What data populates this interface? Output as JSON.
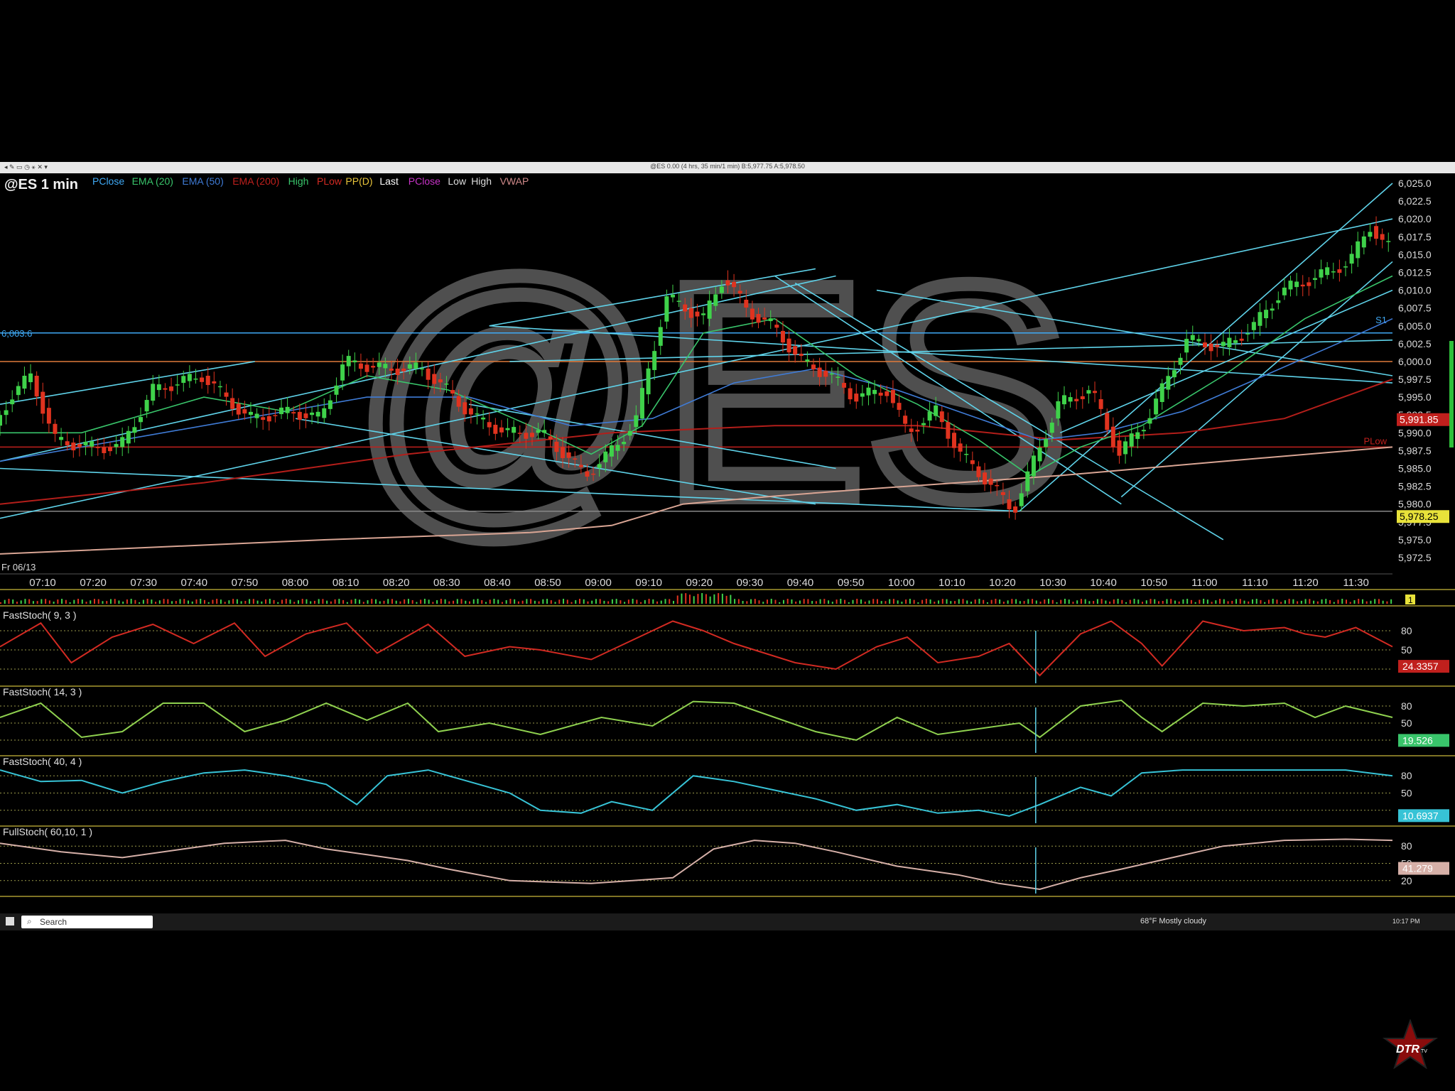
{
  "window": {
    "title": "@ES 0.00 (4 hrs, 35 min/1 min) B:5,977.75 A:5,978.50"
  },
  "chart_header": {
    "symbol": "@ES 1 min",
    "watermark": "@ES",
    "legend": [
      {
        "label": "PClose",
        "color": "#3fa9f5"
      },
      {
        "label": "EMA (20)",
        "color": "#39c56b"
      },
      {
        "label": "EMA (50)",
        "color": "#3f7bd6"
      },
      {
        "label": "EMA (200)",
        "color": "#c0201d"
      },
      {
        "label": "High",
        "color": "#39c56b"
      },
      {
        "label": "PLow",
        "color": "#d22a22"
      },
      {
        "label": "PP(D)",
        "color": "#e8c43a"
      },
      {
        "label": "Last",
        "color": "#ffffff"
      },
      {
        "label": "PClose",
        "color": "#c733c7"
      },
      {
        "label": "Low",
        "color": "#dddddd"
      },
      {
        "label": "High",
        "color": "#dddddd"
      },
      {
        "label": "VWAP",
        "color": "#d08a8a"
      }
    ],
    "date_label": "Fr 06/13",
    "left_level_label": "6,003.6"
  },
  "chart_data": {
    "type": "candlestick",
    "title": "@ES 1 min",
    "x_ticks": [
      "07:10",
      "07:20",
      "07:30",
      "07:40",
      "07:50",
      "08:00",
      "08:10",
      "08:20",
      "08:30",
      "08:40",
      "08:50",
      "09:00",
      "09:10",
      "09:20",
      "09:30",
      "09:40",
      "09:50",
      "10:00",
      "10:10",
      "10:20",
      "10:30",
      "10:40",
      "10:50",
      "11:00",
      "11:10",
      "11:20",
      "11:30"
    ],
    "y_ticks": [
      "6,025.0",
      "6,022.5",
      "6,020.0",
      "6,017.5",
      "6,015.0",
      "6,012.5",
      "6,010.0",
      "6,007.5",
      "6,005.0",
      "6,002.5",
      "6,000.0",
      "5,997.5",
      "5,995.0",
      "5,992.5",
      "5,990.0",
      "5,987.5",
      "5,985.0",
      "5,982.5",
      "5,980.0",
      "5,977.5",
      "5,975.0",
      "5,972.5"
    ],
    "ylim": [
      5971,
      6026
    ],
    "price_path": [
      [
        0,
        5991
      ],
      [
        8,
        5995
      ],
      [
        18,
        5998
      ],
      [
        30,
        5989
      ],
      [
        46,
        5988
      ],
      [
        62,
        5988
      ],
      [
        78,
        5996
      ],
      [
        102,
        5998
      ],
      [
        125,
        5992
      ],
      [
        146,
        5993
      ],
      [
        160,
        5992
      ],
      [
        172,
        6000
      ],
      [
        190,
        5999
      ],
      [
        210,
        5999
      ],
      [
        222,
        5996
      ],
      [
        236,
        5992
      ],
      [
        252,
        5990
      ],
      [
        268,
        5990
      ],
      [
        280,
        5987
      ],
      [
        290,
        5984
      ],
      [
        305,
        5988
      ],
      [
        315,
        5992
      ],
      [
        330,
        6009
      ],
      [
        348,
        6006
      ],
      [
        358,
        6012
      ],
      [
        370,
        6007
      ],
      [
        382,
        6005
      ],
      [
        396,
        6000
      ],
      [
        410,
        5998
      ],
      [
        422,
        5995
      ],
      [
        438,
        5996
      ],
      [
        448,
        5990
      ],
      [
        462,
        5993
      ],
      [
        474,
        5987
      ],
      [
        488,
        5983
      ],
      [
        500,
        5979
      ],
      [
        510,
        5986
      ],
      [
        522,
        5994
      ],
      [
        538,
        5996
      ],
      [
        552,
        5987
      ],
      [
        566,
        5992
      ],
      [
        585,
        6003
      ],
      [
        603,
        6002
      ],
      [
        618,
        6005
      ],
      [
        632,
        6010
      ],
      [
        650,
        6012
      ],
      [
        665,
        6014
      ],
      [
        675,
        6019
      ],
      [
        683,
        6016
      ]
    ],
    "ema20": [
      [
        0,
        5990
      ],
      [
        40,
        5990
      ],
      [
        100,
        5995
      ],
      [
        140,
        5993
      ],
      [
        180,
        5998
      ],
      [
        220,
        5996
      ],
      [
        260,
        5991
      ],
      [
        290,
        5987
      ],
      [
        315,
        5991
      ],
      [
        345,
        6004
      ],
      [
        380,
        6006
      ],
      [
        420,
        5998
      ],
      [
        450,
        5994
      ],
      [
        480,
        5989
      ],
      [
        505,
        5984
      ],
      [
        530,
        5988
      ],
      [
        560,
        5991
      ],
      [
        600,
        5998
      ],
      [
        640,
        6006
      ],
      [
        683,
        6012
      ]
    ],
    "ema50": [
      [
        0,
        5986
      ],
      [
        60,
        5989
      ],
      [
        120,
        5992
      ],
      [
        180,
        5995
      ],
      [
        230,
        5995
      ],
      [
        280,
        5991
      ],
      [
        320,
        5992
      ],
      [
        360,
        5997
      ],
      [
        400,
        5999
      ],
      [
        440,
        5996
      ],
      [
        480,
        5992
      ],
      [
        510,
        5989
      ],
      [
        540,
        5990
      ],
      [
        580,
        5993
      ],
      [
        620,
        5998
      ],
      [
        660,
        6003
      ],
      [
        683,
        6006
      ]
    ],
    "ema200": [
      [
        0,
        5980
      ],
      [
        100,
        5983
      ],
      [
        200,
        5987
      ],
      [
        300,
        5990
      ],
      [
        380,
        5991
      ],
      [
        450,
        5991
      ],
      [
        520,
        5989
      ],
      [
        580,
        5990
      ],
      [
        630,
        5992
      ],
      [
        683,
        5997.5
      ]
    ],
    "vwap": [
      [
        0,
        5973
      ],
      [
        80,
        5974
      ],
      [
        160,
        5975
      ],
      [
        260,
        5976
      ],
      [
        300,
        5977
      ],
      [
        335,
        5980
      ],
      [
        375,
        5981
      ],
      [
        420,
        5982
      ],
      [
        470,
        5983
      ],
      [
        520,
        5984
      ],
      [
        600,
        5986
      ],
      [
        683,
        5988
      ]
    ],
    "levels": [
      {
        "name": "S1",
        "value": 6004,
        "color": "#3fa9f5"
      },
      {
        "name": "PClose",
        "value": 6000,
        "color": "#e07a3a"
      },
      {
        "name": "PLow",
        "value": 5988,
        "color": "#c0201d"
      },
      {
        "name": "",
        "value": 5979,
        "color": "#888888"
      }
    ],
    "price_badges": [
      {
        "text": "5,991.85",
        "value": 5991.85,
        "color": "#c0201d"
      },
      {
        "text": "5,978.25",
        "value": 5978.25,
        "color": "#e8e23a"
      }
    ],
    "level_tags": [
      {
        "text": "S1",
        "value": 6005
      },
      {
        "text": "PLow",
        "value": 5988
      }
    ],
    "trendlines": [
      [
        [
          0,
          5978
        ],
        [
          683,
          6020
        ]
      ],
      [
        [
          0,
          5986
        ],
        [
          410,
          6012
        ]
      ],
      [
        [
          0,
          5994
        ],
        [
          125,
          6000
        ]
      ],
      [
        [
          240,
          6005
        ],
        [
          400,
          6013
        ]
      ],
      [
        [
          240,
          6005
        ],
        [
          683,
          5997
        ]
      ],
      [
        [
          145,
          5992
        ],
        [
          400,
          5980
        ]
      ],
      [
        [
          230,
          5994
        ],
        [
          410,
          5985
        ]
      ],
      [
        [
          380,
          6012
        ],
        [
          550,
          5980
        ]
      ],
      [
        [
          390,
          6011
        ],
        [
          600,
          5975
        ]
      ],
      [
        [
          500,
          5979
        ],
        [
          683,
          6025
        ]
      ],
      [
        [
          430,
          6010
        ],
        [
          683,
          5998
        ]
      ],
      [
        [
          0,
          5985
        ],
        [
          500,
          5979
        ]
      ],
      [
        [
          520,
          5990
        ],
        [
          683,
          6010
        ]
      ],
      [
        [
          250,
          6000
        ],
        [
          683,
          6003
        ]
      ],
      [
        [
          550,
          5981
        ],
        [
          683,
          6014
        ]
      ]
    ],
    "indicators": [
      {
        "label": "FastStoch( 9, 3 )",
        "color": "#d22a22",
        "value_text": "24.3357",
        "badge_color": "#c0201d",
        "ticks": [
          "80",
          "50"
        ],
        "levels": [
          80,
          50,
          20
        ],
        "series": [
          [
            0,
            55
          ],
          [
            20,
            92
          ],
          [
            35,
            30
          ],
          [
            55,
            70
          ],
          [
            75,
            90
          ],
          [
            95,
            60
          ],
          [
            115,
            92
          ],
          [
            130,
            40
          ],
          [
            150,
            75
          ],
          [
            170,
            92
          ],
          [
            185,
            45
          ],
          [
            210,
            90
          ],
          [
            228,
            40
          ],
          [
            250,
            55
          ],
          [
            265,
            50
          ],
          [
            290,
            35
          ],
          [
            310,
            65
          ],
          [
            330,
            95
          ],
          [
            345,
            80
          ],
          [
            360,
            60
          ],
          [
            390,
            30
          ],
          [
            410,
            20
          ],
          [
            430,
            55
          ],
          [
            445,
            70
          ],
          [
            460,
            30
          ],
          [
            480,
            40
          ],
          [
            495,
            60
          ],
          [
            510,
            10
          ],
          [
            530,
            75
          ],
          [
            545,
            95
          ],
          [
            560,
            60
          ],
          [
            570,
            25
          ],
          [
            590,
            95
          ],
          [
            610,
            80
          ],
          [
            630,
            85
          ],
          [
            640,
            75
          ],
          [
            650,
            70
          ],
          [
            665,
            85
          ],
          [
            683,
            55
          ]
        ]
      },
      {
        "label": "FastStoch( 14, 3 )",
        "color": "#8fd14f",
        "value_text": "19.526",
        "badge_color": "#39c56b",
        "ticks": [
          "80",
          "50"
        ],
        "levels": [
          80,
          50,
          20
        ],
        "series": [
          [
            0,
            60
          ],
          [
            20,
            85
          ],
          [
            40,
            25
          ],
          [
            60,
            35
          ],
          [
            80,
            85
          ],
          [
            100,
            85
          ],
          [
            120,
            35
          ],
          [
            140,
            55
          ],
          [
            160,
            85
          ],
          [
            180,
            55
          ],
          [
            200,
            85
          ],
          [
            215,
            35
          ],
          [
            240,
            50
          ],
          [
            265,
            30
          ],
          [
            295,
            60
          ],
          [
            320,
            45
          ],
          [
            340,
            88
          ],
          [
            360,
            85
          ],
          [
            380,
            60
          ],
          [
            400,
            35
          ],
          [
            420,
            20
          ],
          [
            440,
            60
          ],
          [
            460,
            30
          ],
          [
            480,
            40
          ],
          [
            500,
            50
          ],
          [
            510,
            25
          ],
          [
            530,
            80
          ],
          [
            550,
            90
          ],
          [
            560,
            60
          ],
          [
            570,
            35
          ],
          [
            590,
            85
          ],
          [
            610,
            80
          ],
          [
            630,
            85
          ],
          [
            645,
            60
          ],
          [
            660,
            80
          ],
          [
            683,
            60
          ]
        ]
      },
      {
        "label": "FastStoch( 40, 4 )",
        "color": "#37c3d6",
        "value_text": "10.6937",
        "badge_color": "#37c3d6",
        "ticks": [
          "80",
          "50"
        ],
        "levels": [
          80,
          50,
          20
        ],
        "series": [
          [
            0,
            90
          ],
          [
            20,
            70
          ],
          [
            40,
            72
          ],
          [
            60,
            50
          ],
          [
            80,
            70
          ],
          [
            100,
            85
          ],
          [
            120,
            90
          ],
          [
            140,
            80
          ],
          [
            160,
            65
          ],
          [
            175,
            30
          ],
          [
            190,
            80
          ],
          [
            210,
            90
          ],
          [
            230,
            70
          ],
          [
            250,
            50
          ],
          [
            265,
            20
          ],
          [
            285,
            15
          ],
          [
            300,
            35
          ],
          [
            320,
            20
          ],
          [
            340,
            80
          ],
          [
            360,
            70
          ],
          [
            380,
            55
          ],
          [
            400,
            40
          ],
          [
            420,
            20
          ],
          [
            440,
            30
          ],
          [
            460,
            15
          ],
          [
            480,
            20
          ],
          [
            495,
            10
          ],
          [
            510,
            30
          ],
          [
            530,
            60
          ],
          [
            545,
            45
          ],
          [
            560,
            85
          ],
          [
            580,
            90
          ],
          [
            620,
            90
          ],
          [
            660,
            90
          ],
          [
            683,
            80
          ]
        ]
      },
      {
        "label": "FullStoch( 60,10, 1 )",
        "color": "#d6b0a8",
        "value_text": "41.279",
        "badge_color": "#d6b0a8",
        "ticks": [
          "80",
          "50",
          "20"
        ],
        "levels": [
          80,
          50,
          20
        ],
        "series": [
          [
            0,
            85
          ],
          [
            30,
            70
          ],
          [
            60,
            60
          ],
          [
            90,
            75
          ],
          [
            110,
            85
          ],
          [
            140,
            90
          ],
          [
            160,
            75
          ],
          [
            180,
            65
          ],
          [
            200,
            55
          ],
          [
            220,
            40
          ],
          [
            250,
            20
          ],
          [
            290,
            15
          ],
          [
            330,
            25
          ],
          [
            350,
            75
          ],
          [
            370,
            90
          ],
          [
            390,
            85
          ],
          [
            410,
            70
          ],
          [
            440,
            45
          ],
          [
            470,
            30
          ],
          [
            490,
            15
          ],
          [
            510,
            5
          ],
          [
            530,
            25
          ],
          [
            550,
            40
          ],
          [
            575,
            60
          ],
          [
            600,
            80
          ],
          [
            630,
            90
          ],
          [
            660,
            92
          ],
          [
            683,
            90
          ]
        ]
      }
    ],
    "volume_badge": "1"
  },
  "taskbar": {
    "search_placeholder": "Search",
    "weather": "68°F  Mostly cloudy",
    "clock": "10:17 PM"
  },
  "logo": {
    "text": "DTR",
    "sub": "TV"
  }
}
